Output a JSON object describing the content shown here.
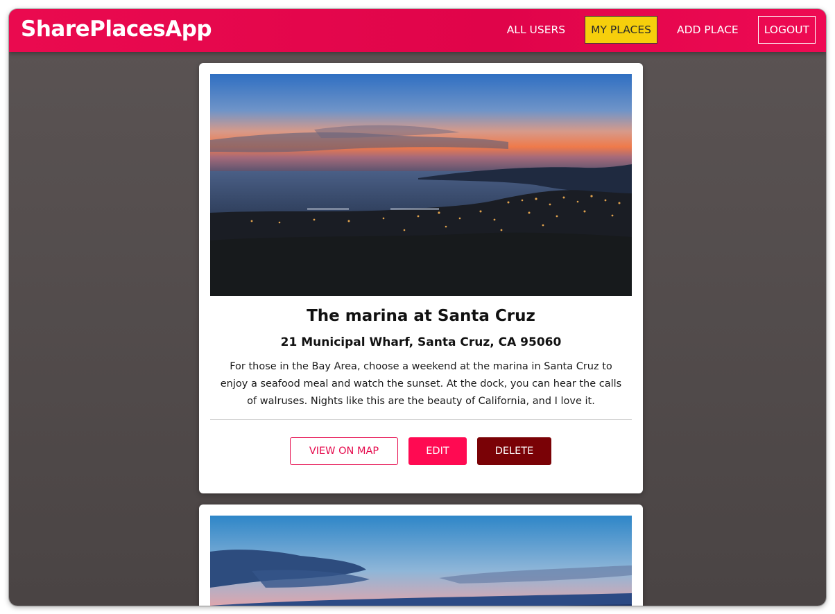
{
  "header": {
    "brand": "SharePlacesApp",
    "nav": {
      "all_users": "ALL USERS",
      "my_places": "MY PLACES",
      "add_place": "ADD PLACE",
      "logout": "LOGOUT"
    },
    "active_item": "MY PLACES"
  },
  "places": [
    {
      "title": "The marina at Santa Cruz",
      "address": "21 Municipal Wharf, Santa Cruz, CA 95060",
      "description": "For those in the Bay Area, choose a weekend at the marina in Santa Cruz to enjoy a seafood meal and watch the sunset. At the dock, you can hear the calls of walruses. Nights like this are the beauty of California, and I love it.",
      "actions": {
        "view_on_map": "VIEW ON MAP",
        "edit": "EDIT",
        "delete": "DELETE"
      }
    }
  ],
  "colors": {
    "header_bg": "#e6064d",
    "active_nav_bg": "#f6cf0c",
    "edit_button": "#ff0a52",
    "delete_button": "#7a0206",
    "page_bg": "#524c4c"
  }
}
